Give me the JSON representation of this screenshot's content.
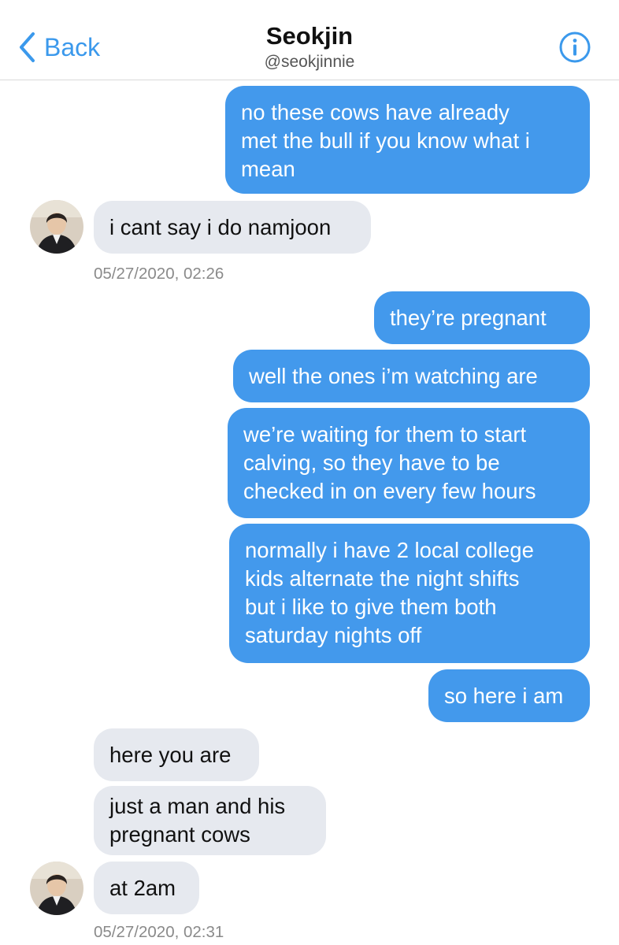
{
  "header": {
    "back_label": "Back",
    "contact_name": "Seokjin",
    "contact_handle": "@seokjinnie",
    "back_icon": "chevron-left-icon",
    "info_icon": "info-circle-icon"
  },
  "colors": {
    "accent": "#3b99ec",
    "sent_bubble": "#4399ec",
    "received_bubble": "#e6e9ef",
    "timestamp": "#8a8a8a"
  },
  "messages": [
    {
      "from": "me",
      "lines": [
        "no these cows have already",
        "met the bull if you know what i",
        "mean"
      ]
    },
    {
      "from": "them",
      "lines": [
        "i cant say i do namjoon"
      ]
    },
    {
      "timestamp": "05/27/2020, 02:26"
    },
    {
      "from": "me",
      "lines": [
        "they’re pregnant"
      ]
    },
    {
      "from": "me",
      "lines": [
        "well the ones i’m watching are"
      ]
    },
    {
      "from": "me",
      "lines": [
        "we’re waiting for them to start",
        "calving, so they have to be",
        "checked in on every few hours"
      ]
    },
    {
      "from": "me",
      "lines": [
        "normally i have 2 local college",
        "kids alternate the night shifts",
        "but i like to give them both",
        "saturday nights off"
      ]
    },
    {
      "from": "me",
      "lines": [
        "so here i am"
      ]
    },
    {
      "from": "them",
      "lines": [
        "here you are"
      ]
    },
    {
      "from": "them",
      "lines": [
        "just a man and his",
        "pregnant cows"
      ]
    },
    {
      "from": "them",
      "lines": [
        "at 2am"
      ]
    },
    {
      "timestamp": "05/27/2020, 02:31"
    }
  ]
}
